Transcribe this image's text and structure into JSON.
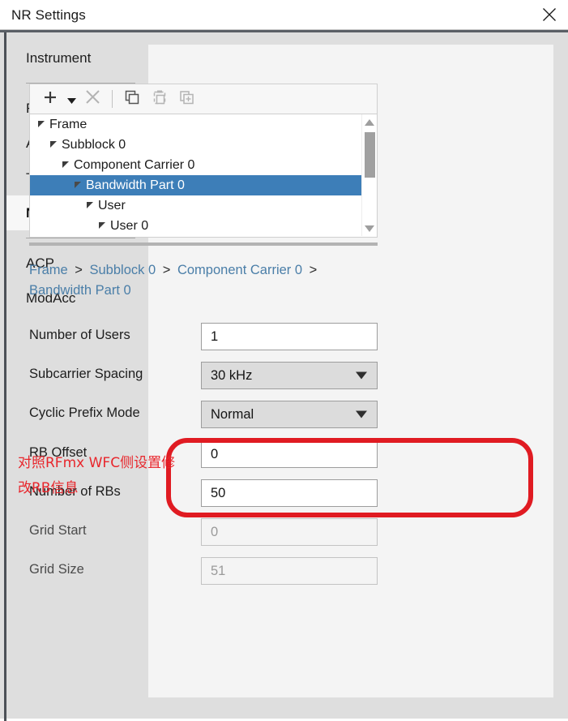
{
  "window": {
    "title": "NR Settings",
    "close_icon": "close-icon"
  },
  "sidebar": {
    "items": [
      {
        "label": "Instrument",
        "selected": false
      },
      {
        "label": "Frequency",
        "selected": false
      },
      {
        "label": "Amplitude",
        "selected": false
      },
      {
        "label": "Trigger",
        "selected": false
      },
      {
        "label": "NR",
        "selected": true
      },
      {
        "label": "ACP",
        "selected": false
      },
      {
        "label": "ModAcc",
        "selected": false
      }
    ]
  },
  "toolbar": {
    "buttons": [
      {
        "name": "add-button",
        "icon": "plus-icon",
        "enabled": true
      },
      {
        "name": "add-dropdown-button",
        "icon": "chevron-down-icon",
        "enabled": true
      },
      {
        "name": "delete-button",
        "icon": "close-x-icon",
        "enabled": false
      },
      {
        "name": "copy-button",
        "icon": "copy-icon",
        "enabled": true
      },
      {
        "name": "paste-button",
        "icon": "paste-icon",
        "enabled": false
      },
      {
        "name": "duplicate-button",
        "icon": "duplicate-icon",
        "enabled": false
      }
    ]
  },
  "tree": {
    "nodes": [
      {
        "label": "Frame",
        "depth": 0,
        "selected": false,
        "expanded": true
      },
      {
        "label": "Subblock 0",
        "depth": 1,
        "selected": false,
        "expanded": true
      },
      {
        "label": "Component Carrier 0",
        "depth": 2,
        "selected": false,
        "expanded": true
      },
      {
        "label": "Bandwidth Part 0",
        "depth": 3,
        "selected": true,
        "expanded": true
      },
      {
        "label": "User",
        "depth": 4,
        "selected": false,
        "expanded": true
      },
      {
        "label": "User 0",
        "depth": 5,
        "selected": false,
        "expanded": true
      }
    ],
    "scrollbar": {
      "up_icon": "scroll-up-arrow-icon",
      "down_icon": "scroll-down-arrow-icon"
    }
  },
  "breadcrumb": {
    "parts": [
      "Frame",
      "Subblock 0",
      "Component Carrier 0",
      "Bandwidth Part 0"
    ],
    "separator": ">"
  },
  "form": {
    "rows": [
      {
        "label": "Number of Users",
        "value": "1",
        "type": "text",
        "enabled": true
      },
      {
        "label": "Subcarrier Spacing",
        "value": "30 kHz",
        "type": "combo",
        "enabled": true
      },
      {
        "label": "Cyclic Prefix Mode",
        "value": "Normal",
        "type": "combo",
        "enabled": true
      },
      {
        "label": "RB Offset",
        "value": "0",
        "type": "text",
        "enabled": true
      },
      {
        "label": "Number of RBs",
        "value": "50",
        "type": "text",
        "enabled": true
      },
      {
        "label": "Grid Start",
        "value": "0",
        "type": "text",
        "enabled": false
      },
      {
        "label": "Grid Size",
        "value": "51",
        "type": "text",
        "enabled": false
      }
    ]
  },
  "annotation": {
    "text": "对照RFmx WFC侧设置修改RB信息",
    "color": "#e8262c",
    "box_color": "#e01b22"
  },
  "colors": {
    "selection_blue": "#3d7eb8",
    "breadcrumb_link": "#4a7ea8",
    "sidebar_bg": "#dedede",
    "content_bg": "#f4f4f4"
  }
}
